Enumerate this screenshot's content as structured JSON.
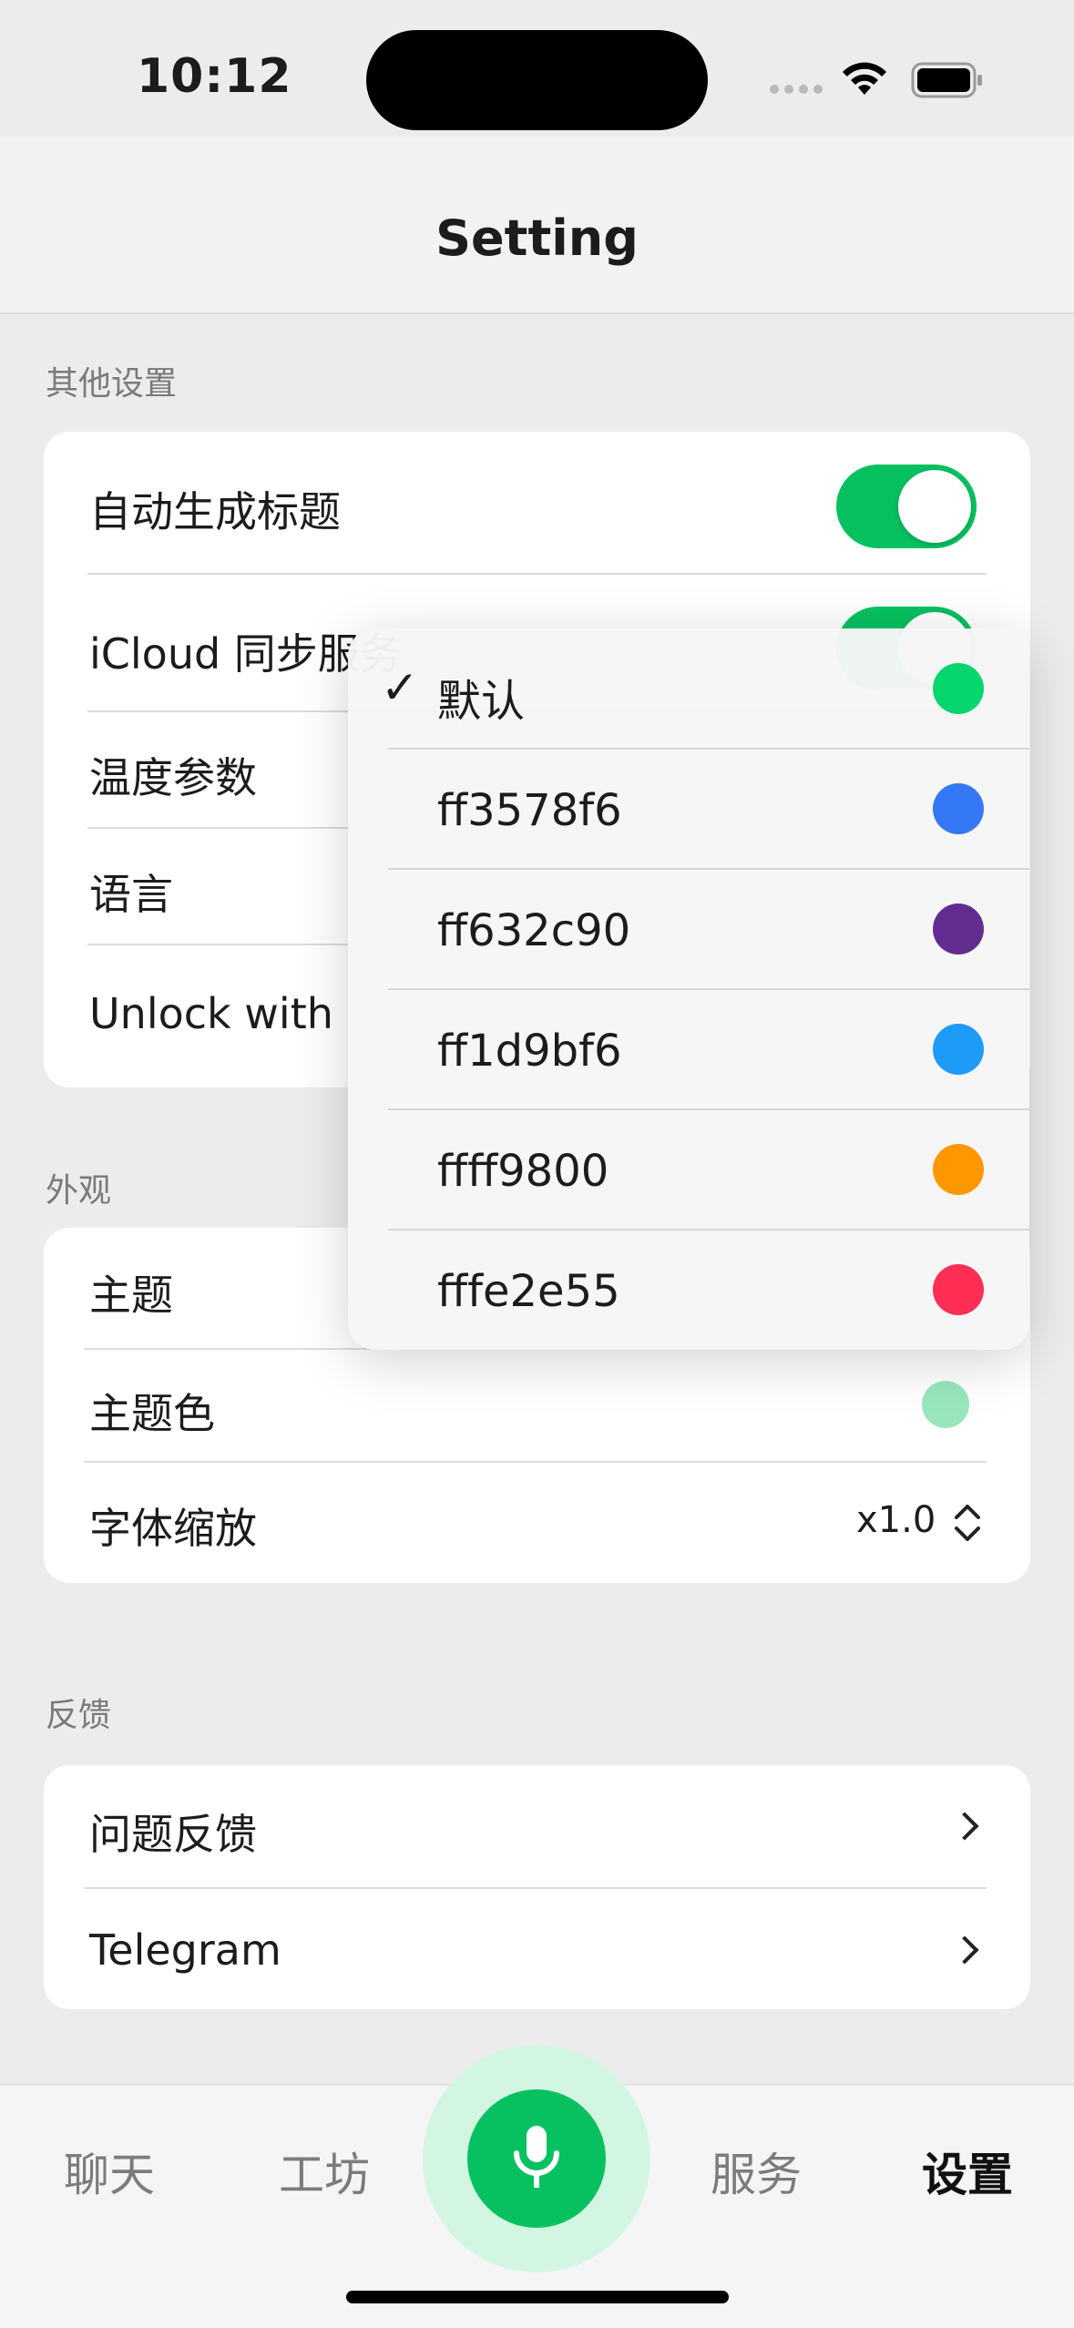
{
  "status": {
    "time": "10:12"
  },
  "nav": {
    "title": "Setting"
  },
  "other": {
    "header": "其他设置",
    "rows": [
      {
        "label": "自动生成标题",
        "toggle": true
      },
      {
        "label": "iCloud 同步服务",
        "toggle": true
      },
      {
        "label": "温度参数"
      },
      {
        "label": "语言"
      },
      {
        "label": "Unlock with"
      }
    ]
  },
  "appearance": {
    "header": "外观",
    "rows": [
      {
        "label": "主题"
      },
      {
        "label": "主题色",
        "swatch": "#99e6bd"
      },
      {
        "label": "字体缩放",
        "value": "x1.0"
      }
    ]
  },
  "feedback": {
    "header": "反馈",
    "rows": [
      {
        "label": "问题反馈"
      },
      {
        "label": "Telegram"
      }
    ]
  },
  "theme_menu": {
    "items": [
      {
        "label": "默认",
        "color": "#07d66f",
        "selected": true,
        "check": "✓"
      },
      {
        "label": "ff3578f6",
        "color": "#3578f6"
      },
      {
        "label": "ff632c90",
        "color": "#632c90"
      },
      {
        "label": "ff1d9bf6",
        "color": "#1d9bf6"
      },
      {
        "label": "ffff9800",
        "color": "#ff9800"
      },
      {
        "label": "fffe2e55",
        "color": "#fe2e55"
      }
    ]
  },
  "tabs": [
    "聊天",
    "工坊",
    "服务",
    "设置"
  ],
  "colors": {
    "accent": "#07c160"
  }
}
